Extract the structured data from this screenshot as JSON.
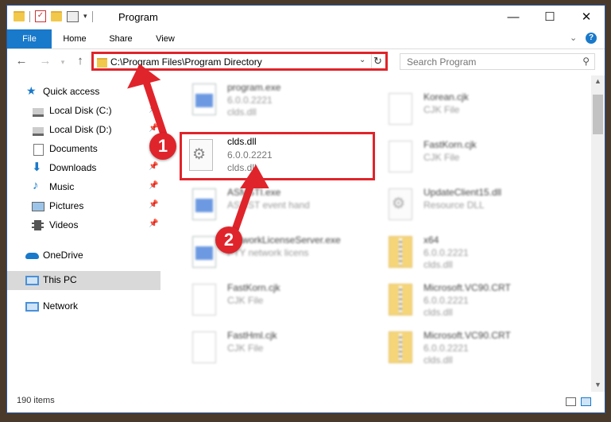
{
  "window": {
    "title": "Program",
    "controls": {
      "minimize": "—",
      "maximize": "☐",
      "close": "✕"
    }
  },
  "ribbon": {
    "tabs": [
      {
        "label": "File"
      },
      {
        "label": "Home"
      },
      {
        "label": "Share"
      },
      {
        "label": "View"
      }
    ],
    "help": "?"
  },
  "address": {
    "path": "C:\\Program Files\\Program Directory"
  },
  "search": {
    "placeholder": "Search Program"
  },
  "sidebar": {
    "items": [
      {
        "label": "Quick access"
      },
      {
        "label": "Local Disk (C:)"
      },
      {
        "label": "Local Disk (D:)"
      },
      {
        "label": "Documents"
      },
      {
        "label": "Downloads"
      },
      {
        "label": "Music"
      },
      {
        "label": "Pictures"
      },
      {
        "label": "Videos"
      },
      {
        "label": "OneDrive"
      },
      {
        "label": "This PC"
      },
      {
        "label": "Network"
      }
    ]
  },
  "files": {
    "left": [
      {
        "name": "program.exe",
        "l1": "6.0.0.2221",
        "l2": "clds.dll",
        "icon": "exe-file-icon"
      },
      {
        "name": "clds.dll",
        "l1": "6.0.0.2221",
        "l2": "clds.dll",
        "icon": "gear-file-icon"
      },
      {
        "name": "ASMSTI.exe",
        "l1": "ASMST event hand",
        "l2": "",
        "icon": "exe-file-icon"
      },
      {
        "name": "NetworkLicenseServer.exe",
        "l1": "PTY network licens",
        "l2": "",
        "icon": "exe-file-icon"
      },
      {
        "name": "FastKorn.cjk",
        "l1": "CJK File",
        "l2": "",
        "icon": "document-icon"
      },
      {
        "name": "FastHml.cjk",
        "l1": "CJK File",
        "l2": "",
        "icon": "document-icon"
      }
    ],
    "right": [
      {
        "name": "Korean.cjk",
        "l1": "CJK File",
        "l2": "",
        "icon": "document-icon"
      },
      {
        "name": "FastKorn.cjk",
        "l1": "CJK File",
        "l2": "",
        "icon": "document-icon"
      },
      {
        "name": "UpdateClient15.dll",
        "l1": "Resource DLL",
        "l2": "",
        "icon": "gear-file-icon"
      },
      {
        "name": "x64",
        "l1": "6.0.0.2221",
        "l2": "clds.dll",
        "icon": "zip-folder-icon"
      },
      {
        "name": "Microsoft.VC90.CRT",
        "l1": "6.0.0.2221",
        "l2": "clds.dll",
        "icon": "zip-folder-icon"
      },
      {
        "name": "Microsoft.VC90.CRT",
        "l1": "6.0.0.2221",
        "l2": "clds.dll",
        "icon": "zip-folder-icon"
      }
    ]
  },
  "status": {
    "count": "190 items"
  },
  "annotations": [
    {
      "label": "1"
    },
    {
      "label": "2"
    }
  ],
  "colors": {
    "accent": "#1979ca",
    "highlight": "#e0242b",
    "selected": "#d9d9d9"
  }
}
